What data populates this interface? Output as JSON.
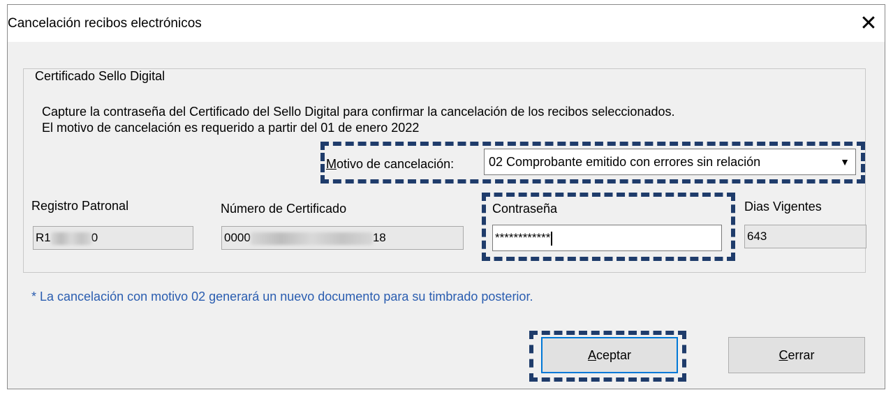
{
  "dialog": {
    "title": "Cancelación recibos electrónicos",
    "close_glyph": "✕"
  },
  "group": {
    "legend": "Certificado Sello Digital",
    "instruction_line1": "Capture la contraseña del Certificado del Sello Digital para confirmar la cancelación de los recibos seleccionados.",
    "instruction_line2": "El motivo de cancelación es requerido a partir del 01 de enero 2022"
  },
  "motivo": {
    "label_first": "M",
    "label_rest": "otivo de cancelación:",
    "selected": "02 Comprobante emitido con errores sin relación",
    "arrow": "▼"
  },
  "fields": {
    "registro_label": "Registro Patronal",
    "registro_prefix": "R1",
    "registro_suffix": "0",
    "certificado_label": "Número de Certificado",
    "certificado_prefix": "0000",
    "certificado_suffix": "18",
    "contrasena_label": "Contraseña",
    "contrasena_value": "************",
    "dias_label": "Dias Vigentes",
    "dias_value": "643"
  },
  "note": "* La cancelación con motivo 02 generará un nuevo documento para su timbrado posterior.",
  "buttons": {
    "aceptar_first": "A",
    "aceptar_rest": "ceptar",
    "cerrar_first": "C",
    "cerrar_rest": "errar"
  },
  "colors": {
    "highlight": "#1f3c6b",
    "note": "#2a5db0",
    "dialog_bg": "#f0f0f0"
  }
}
